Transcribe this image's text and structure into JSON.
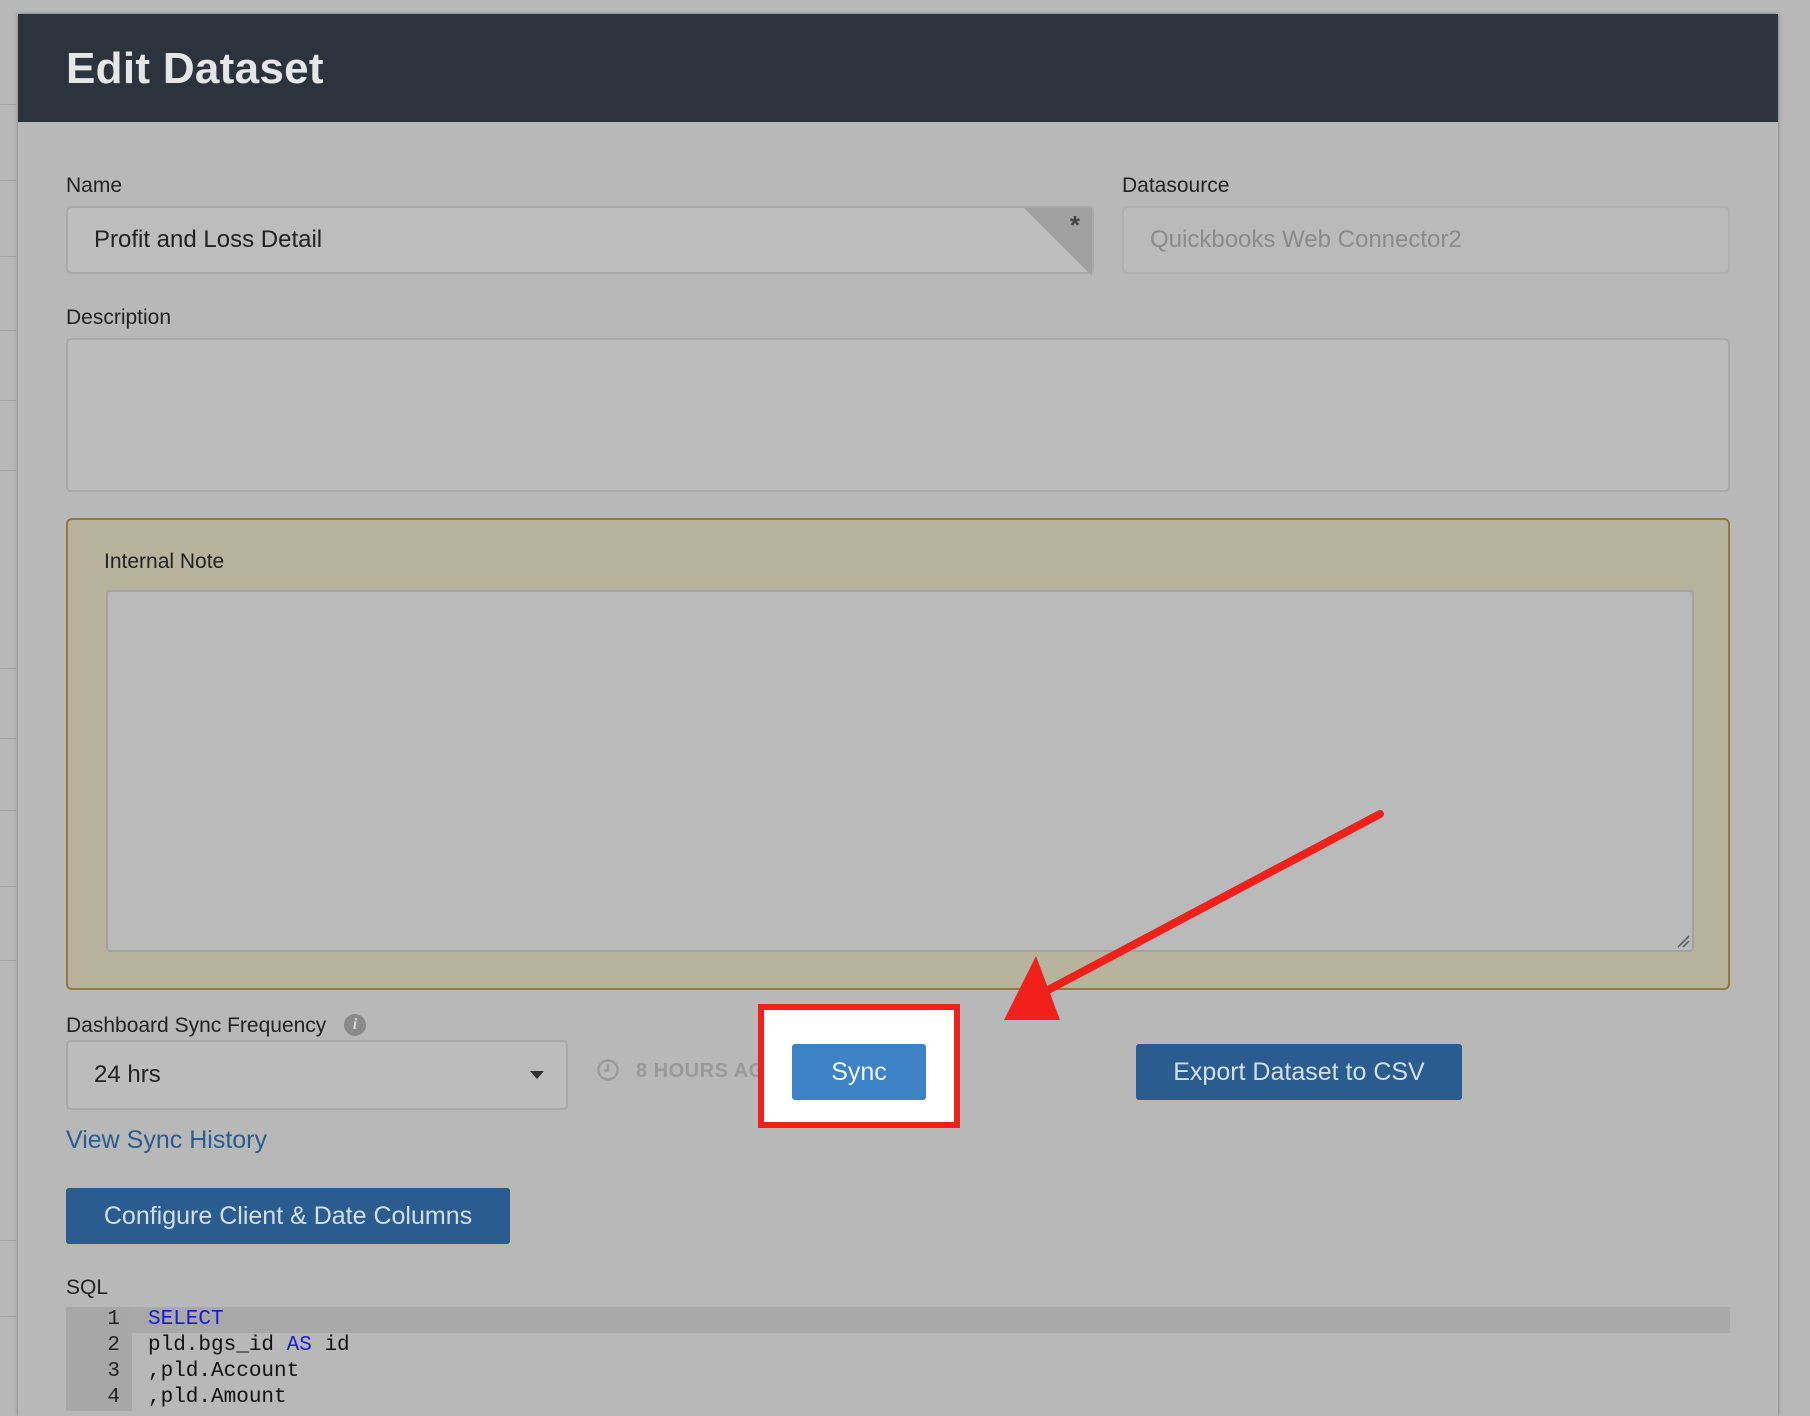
{
  "modal": {
    "title": "Edit Dataset"
  },
  "form": {
    "name_label": "Name",
    "name_value": "Profit and Loss Detail",
    "required_marker": "*",
    "datasource_label": "Datasource",
    "datasource_placeholder": "Quickbooks Web Connector2",
    "description_label": "Description",
    "description_value": "",
    "internal_note_label": "Internal Note",
    "internal_note_value": "",
    "sync_frequency_label": "Dashboard Sync Frequency",
    "sync_frequency_value": "24 hrs",
    "last_synced": "8 HOURS AGO"
  },
  "buttons": {
    "sync": "Sync",
    "export": "Export Dataset to CSV",
    "configure": "Configure Client & Date Columns"
  },
  "links": {
    "view_sync_history": "View Sync History"
  },
  "sql": {
    "label": "SQL",
    "lines": [
      {
        "num": "1",
        "keyword": "SELECT",
        "text": "",
        "keyword2": "",
        "text2": ""
      },
      {
        "num": "2",
        "keyword": "",
        "text": "pld.bgs_id ",
        "keyword2": "AS",
        "text2": " id"
      },
      {
        "num": "3",
        "keyword": "",
        "text": ",pld.Account",
        "keyword2": "",
        "text2": ""
      },
      {
        "num": "4",
        "keyword": "",
        "text": ",pld.Amount",
        "keyword2": "",
        "text2": ""
      }
    ]
  },
  "colors": {
    "header_bg": "#2c333d",
    "primary_button": "#2a5c8f",
    "sync_button": "#3d82c4",
    "annotation_red": "#f0201b",
    "note_border": "#8f7a3c"
  },
  "icons": {
    "info": "info-icon",
    "clock": "clock-icon",
    "caret": "caret-down-icon",
    "annotation": "red-arrow-annotation"
  }
}
